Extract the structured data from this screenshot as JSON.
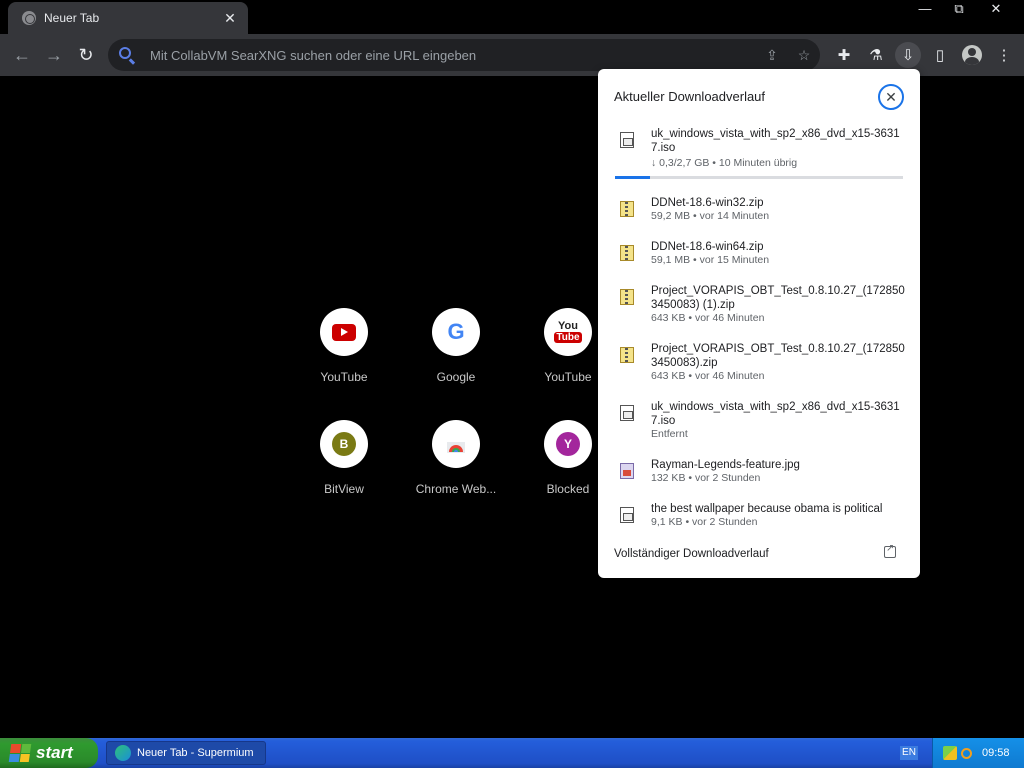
{
  "tab": {
    "title": "Neuer Tab"
  },
  "window_controls": {
    "minimize": "—",
    "restore": "⧉",
    "close": "✕"
  },
  "toolbar": {
    "back": "←",
    "forward": "→",
    "reload": "↻",
    "omnibox_placeholder": "Mit CollabVM SearXNG suchen oder eine URL eingeben",
    "share": "⇪",
    "star": "☆",
    "extensions": "✚",
    "labs": "⚗",
    "download": "⇩",
    "sidepanel": "▯",
    "menu": "⋮"
  },
  "shortcuts": [
    {
      "label": "YouTube",
      "glyph": "▶",
      "color": "#cc0000"
    },
    {
      "label": "Google",
      "glyph": "G",
      "color": "#4285f4"
    },
    {
      "label": "YouTube",
      "glyph": "You Tube",
      "color": "#cc0000"
    },
    {
      "label": "BitView",
      "glyph": "B",
      "color": "#7a7a14"
    },
    {
      "label": "Chrome Web...",
      "glyph": "◒",
      "color": "#e94235"
    },
    {
      "label": "Blocked",
      "glyph": "Y",
      "color": "#a3269c"
    }
  ],
  "downloads": {
    "header": "Aktueller Downloadverlauf",
    "close": "✕",
    "items": [
      {
        "name": "uk_windows_vista_with_sp2_x86_dvd_x15-36317.iso",
        "status": "↓ 0,3/2,7 GB • 10 Minuten übrig",
        "type": "iso",
        "progress": 0.12
      },
      {
        "name": "DDNet-18.6-win32.zip",
        "status": "59,2 MB • vor 14 Minuten",
        "type": "zip"
      },
      {
        "name": "DDNet-18.6-win64.zip",
        "status": "59,1 MB • vor 15 Minuten",
        "type": "zip"
      },
      {
        "name": "Project_VORAPIS_OBT_Test_0.8.10.27_(1728503450083) (1).zip",
        "status": "643 KB • vor 46 Minuten",
        "type": "zip"
      },
      {
        "name": "Project_VORAPIS_OBT_Test_0.8.10.27_(1728503450083).zip",
        "status": "643 KB • vor 46 Minuten",
        "type": "zip"
      },
      {
        "name": "uk_windows_vista_with_sp2_x86_dvd_x15-36317.iso",
        "status": "Entfernt",
        "type": "iso"
      },
      {
        "name": "Rayman-Legends-feature.jpg",
        "status": "132 KB • vor 2 Stunden",
        "type": "jpg"
      },
      {
        "name": "the best wallpaper because obama is political",
        "status": "9,1 KB • vor 2 Stunden",
        "type": "iso"
      }
    ],
    "full_history": "Vollständiger Downloadverlauf"
  },
  "taskbar": {
    "start": "start",
    "task": "Neuer Tab - Supermium",
    "lang": "EN",
    "time": "09:58"
  }
}
